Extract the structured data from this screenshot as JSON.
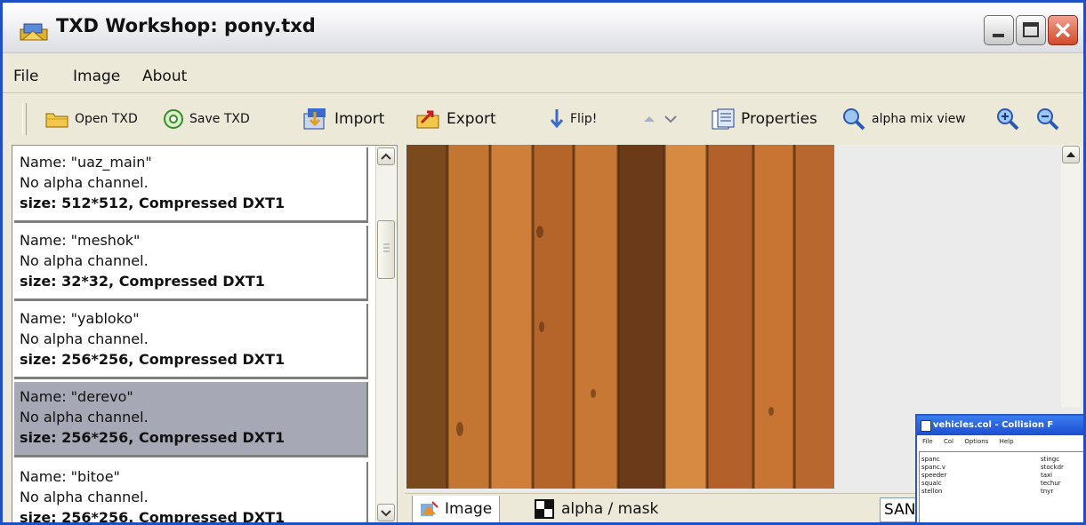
{
  "window": {
    "title": "TXD Workshop: pony.txd"
  },
  "menu": [
    "File",
    "Image",
    "About"
  ],
  "toolbar": {
    "open": "Open TXD",
    "save": "Save TXD",
    "import": "Import",
    "export": "Export",
    "flip": "Flip!",
    "properties": "Properties",
    "alpha_mix": "alpha mix view"
  },
  "textures": [
    {
      "name": "Name: \"uaz_main\"",
      "alpha": "No alpha channel.",
      "size": "size: 512*512, Compressed DXT1",
      "selected": false
    },
    {
      "name": "Name: \"meshok\"",
      "alpha": "No alpha channel.",
      "size": "size: 32*32, Compressed DXT1",
      "selected": false
    },
    {
      "name": "Name: \"yabloko\"",
      "alpha": "No alpha channel.",
      "size": "size: 256*256, Compressed DXT1",
      "selected": false
    },
    {
      "name": "Name: \"derevo\"",
      "alpha": "No alpha channel.",
      "size": "size: 256*256, Compressed DXT1",
      "selected": true
    },
    {
      "name": "Name: \"bitoe\"",
      "alpha": "No alpha channel.",
      "size": "size: 256*256, Compressed DXT1",
      "selected": false
    }
  ],
  "tabs": {
    "image": "Image",
    "alpha": "alpha / mask"
  },
  "field": {
    "value": "SAN"
  },
  "mini_window": {
    "title": "vehicles.col - Collision F",
    "menu": [
      "File",
      "Col",
      "Options",
      "Help"
    ],
    "left": [
      "spanc",
      "spanc.v",
      "speeder",
      "squalc",
      "stellon"
    ],
    "right": [
      "stingc",
      "stockdr",
      "taxi",
      "techur",
      "tnyr"
    ]
  },
  "colors": {
    "selection": "#a7a8b5",
    "window_border": "#1f4fc4",
    "face": "#ece9d8"
  }
}
